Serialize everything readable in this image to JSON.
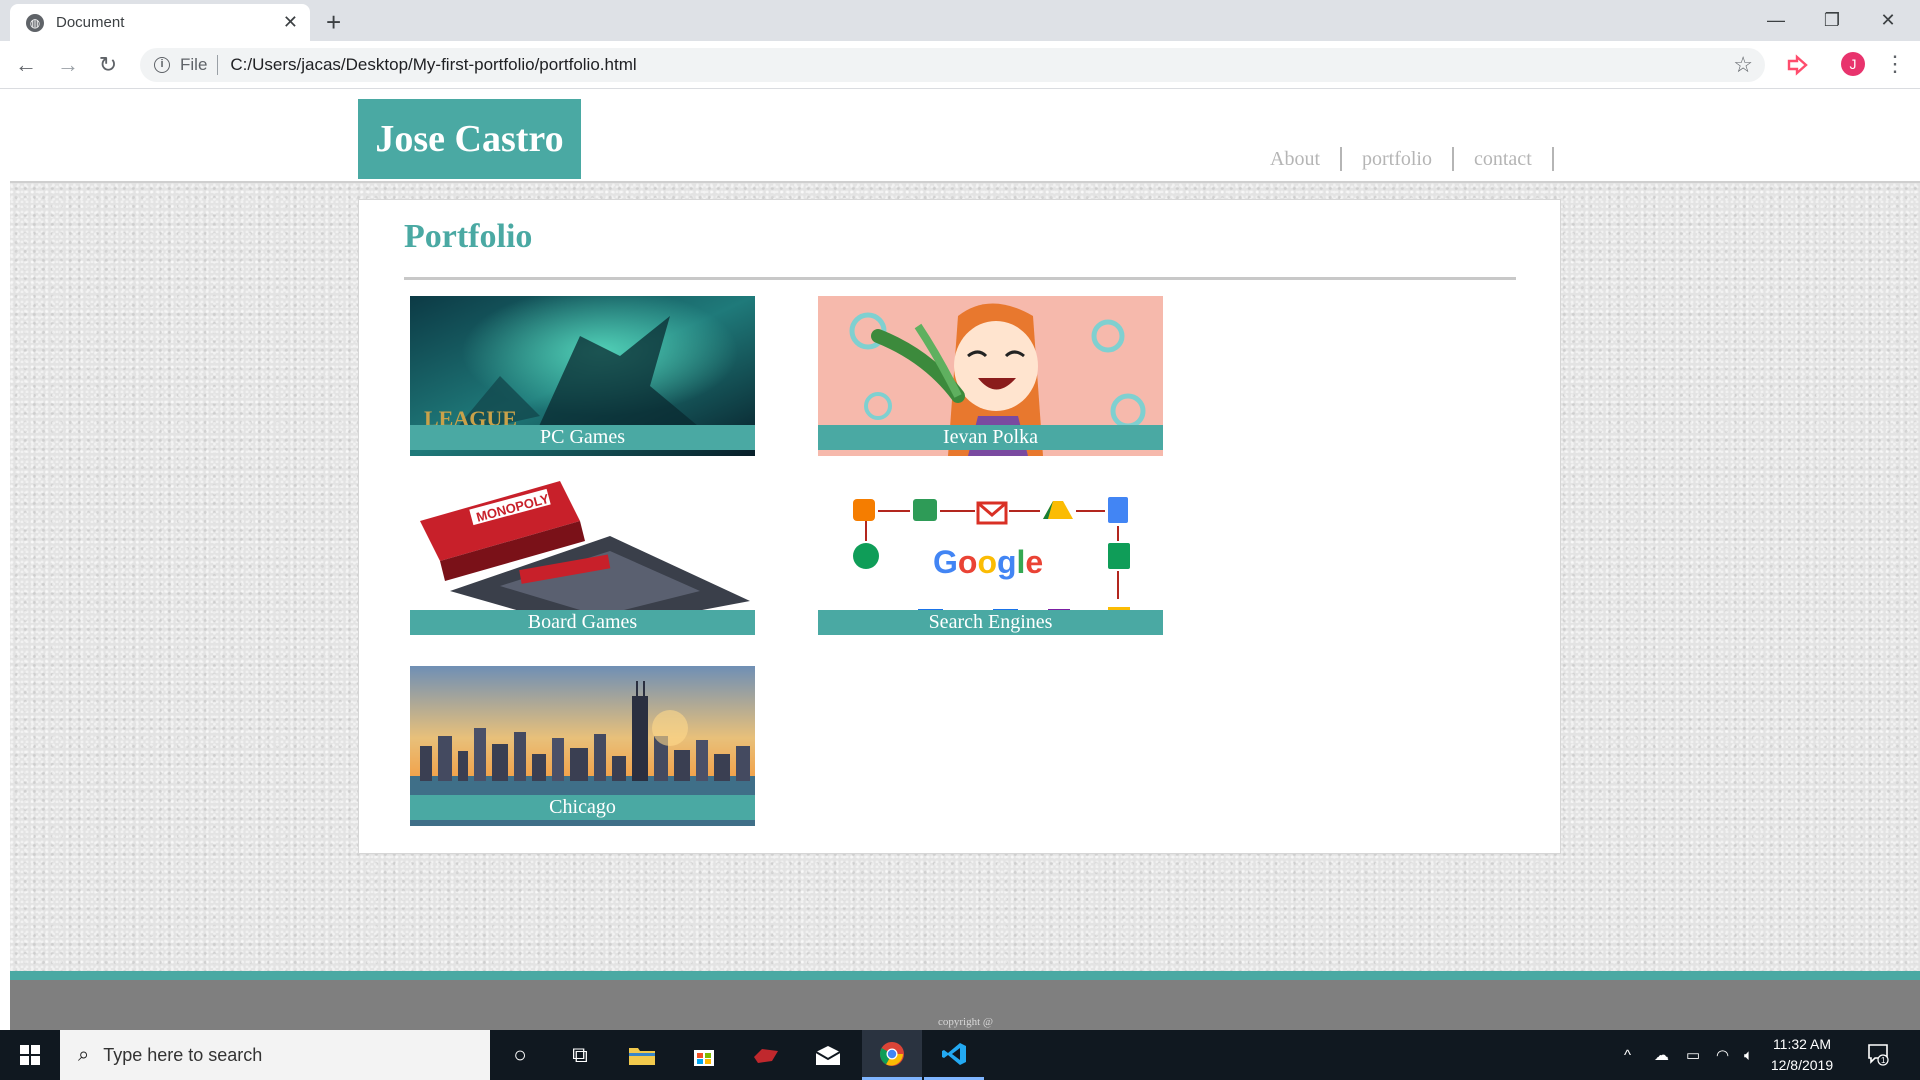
{
  "browser": {
    "tab_title": "Document",
    "tab_close": "✕",
    "new_tab": "+",
    "address_scheme": "File",
    "address_url": "C:/Users/jacas/Desktop/My-first-portfolio/portfolio.html",
    "profile_initial": "J"
  },
  "site": {
    "logo": "Jose Castro",
    "nav": [
      "About",
      "portfolio",
      "contact"
    ],
    "heading": "Portfolio",
    "cards": [
      {
        "caption": "PC Games",
        "image": "league-of-legends-art"
      },
      {
        "caption": "Ievan Polka",
        "image": "anime-girl-leek"
      },
      {
        "caption": "Board Games",
        "image": "monopoly-box"
      },
      {
        "caption": "Search Engines",
        "image": "google-services-diagram"
      },
      {
        "caption": "Chicago",
        "image": "chicago-skyline"
      }
    ],
    "footer": "copyright @"
  },
  "taskbar": {
    "search_placeholder": "Type here to search",
    "time": "11:32 AM",
    "date": "12/8/2019",
    "notification_count": "1"
  },
  "colors": {
    "accent": "#4aa9a3",
    "footer": "#7f7f7f",
    "nav_text": "#b5b5b5"
  }
}
